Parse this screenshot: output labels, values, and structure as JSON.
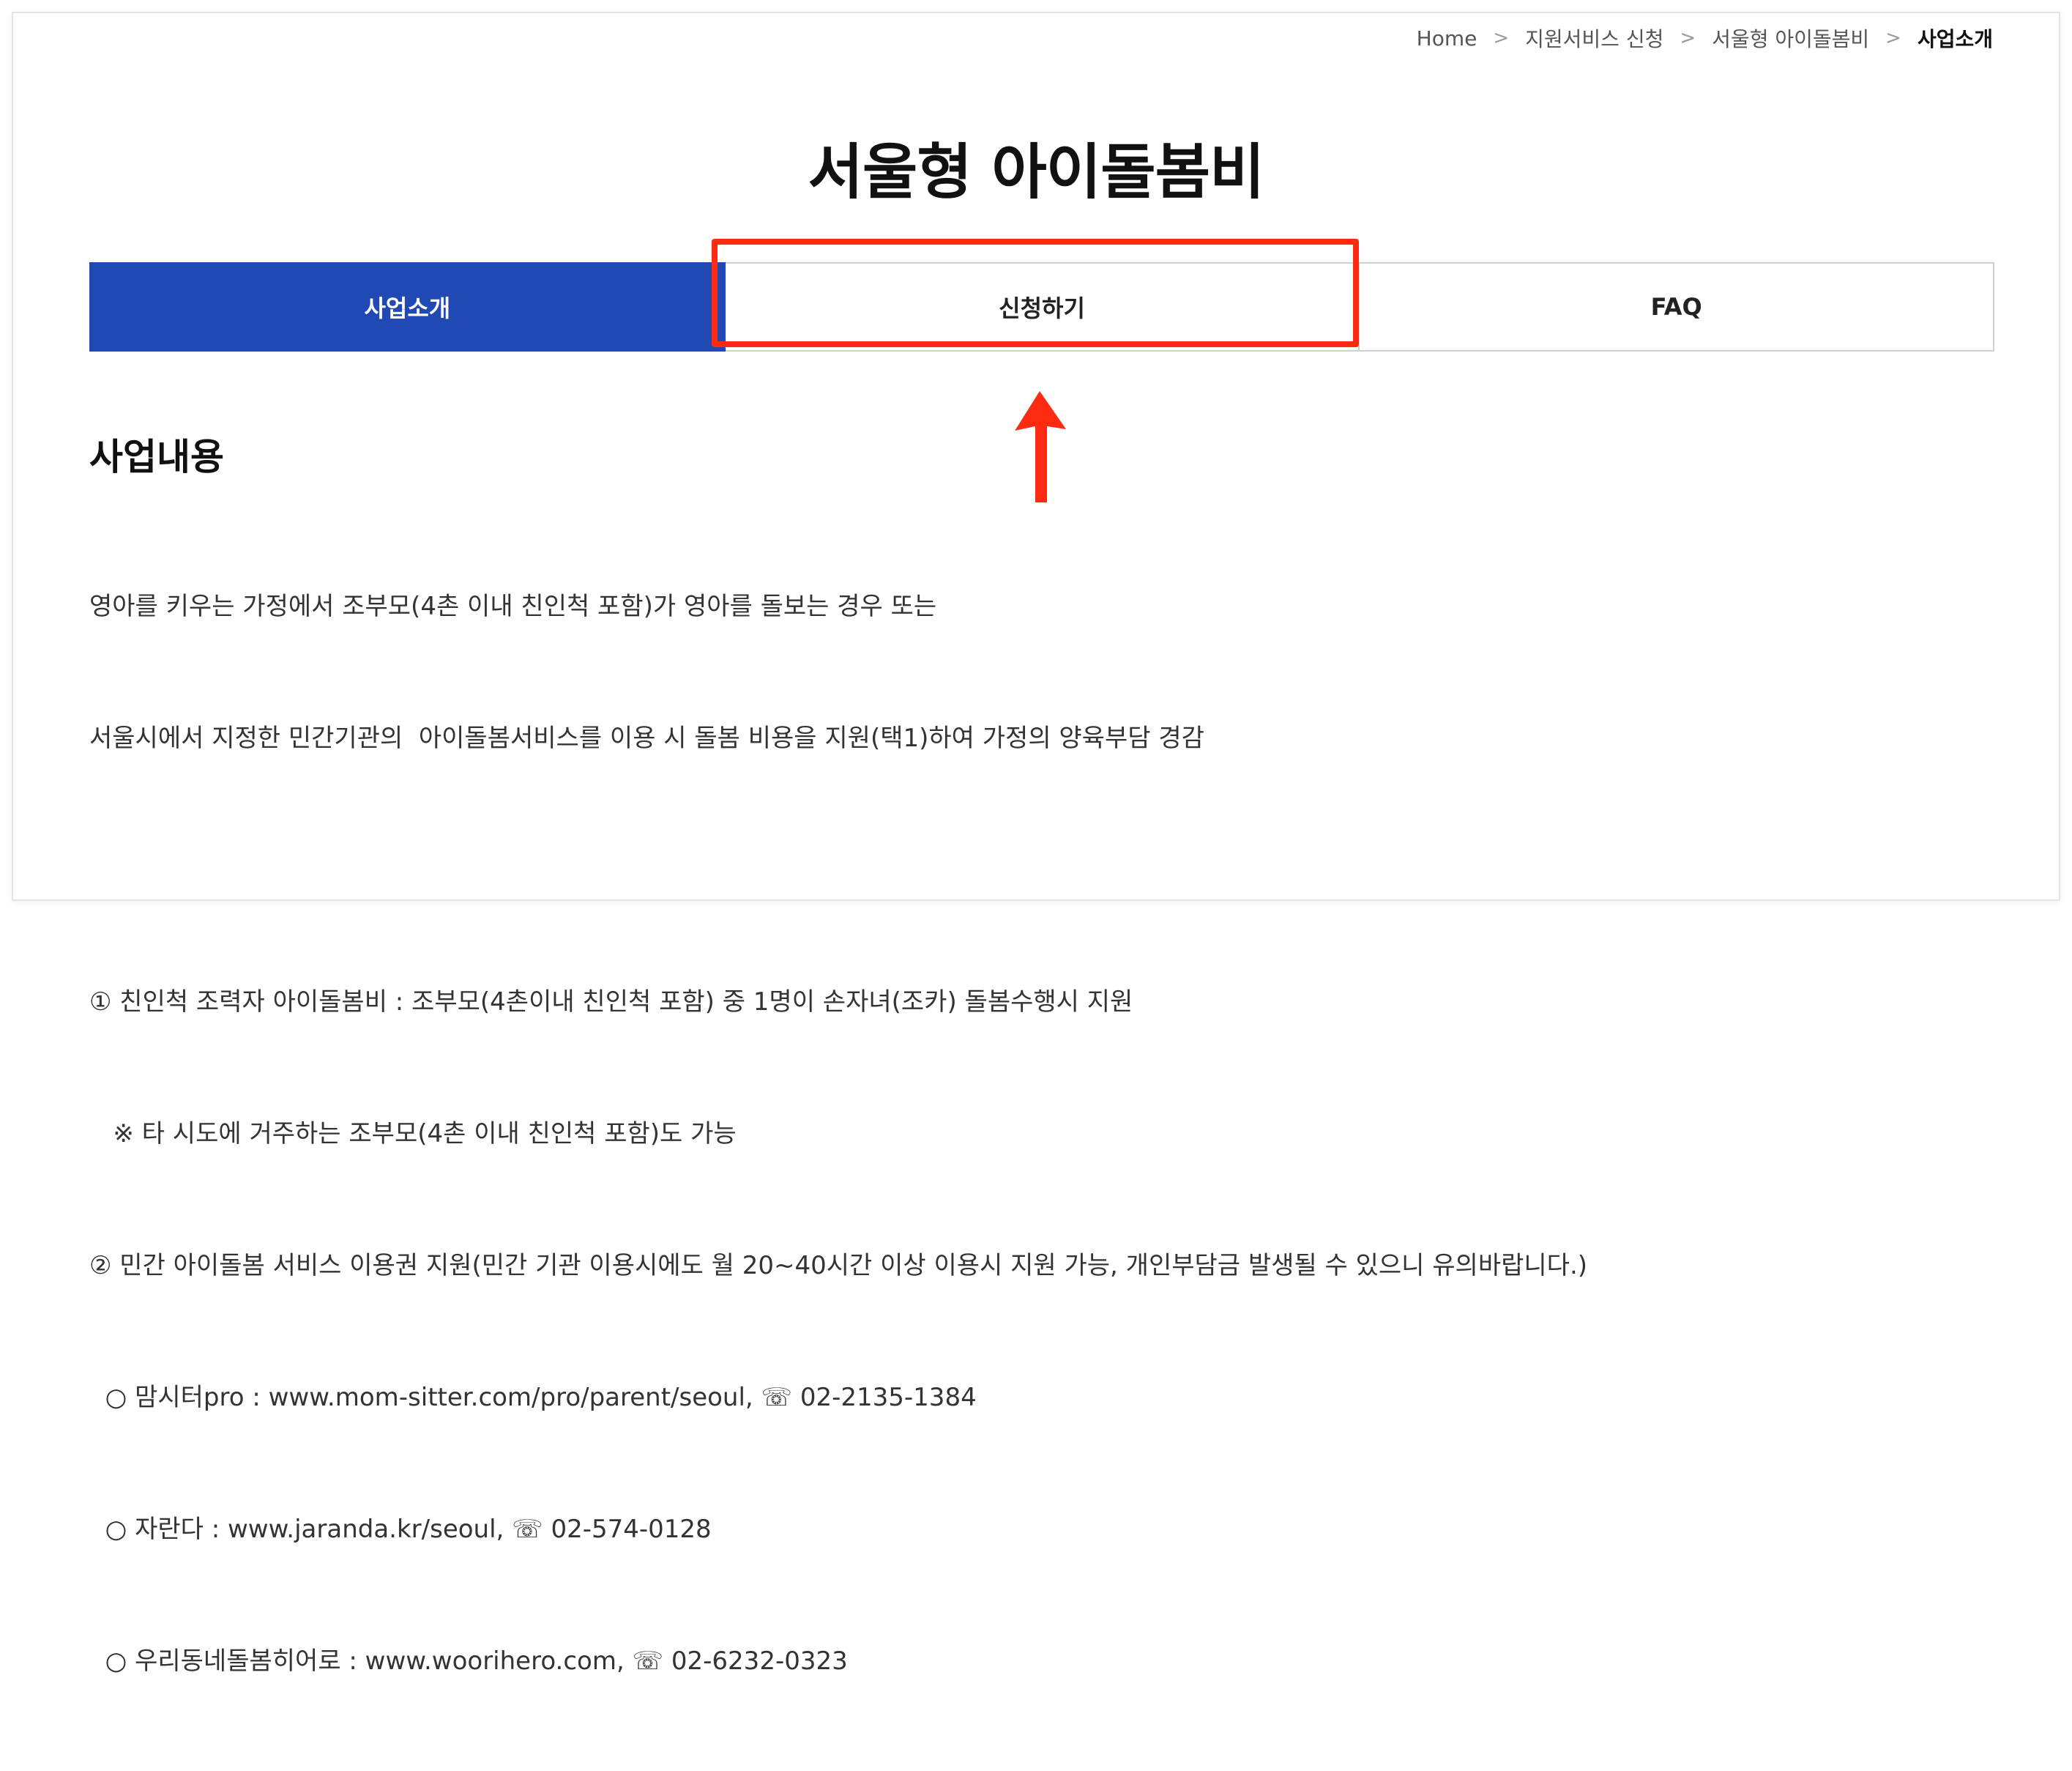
{
  "breadcrumb": {
    "items": [
      "Home",
      "지원서비스 신청",
      "서울형 아이돌봄비",
      "사업소개"
    ],
    "separator": ">"
  },
  "page": {
    "title": "서울형 아이돌봄비"
  },
  "tabs": [
    {
      "label": "사업소개",
      "active": true
    },
    {
      "label": "신청하기",
      "active": false
    },
    {
      "label": "FAQ",
      "active": false
    }
  ],
  "annotation": {
    "highlight_color": "#ff2a12"
  },
  "section": {
    "heading": "사업내용",
    "lines": [
      "영아를 키우는 가정에서 조부모(4촌 이내 친인척 포함)가 영아를 돌보는 경우 또는",
      "서울시에서 지정한 민간기관의  아이돌봄서비스를 이용 시 돌봄 비용을 지원(택1)하여 가정의 양육부담 경감",
      "",
      "① 친인척 조력자 아이돌봄비 : 조부모(4촌이내 친인척 포함) 중 1명이 손자녀(조카) 돌봄수행시 지원",
      "   ※ 타 시도에 거주하는 조부모(4촌 이내 친인척 포함)도 가능",
      "② 민간 아이돌봄 서비스 이용권 지원(민간 기관 이용시에도 월 20~40시간 이상 이용시 지원 가능, 개인부담금 발생될 수 있으니 유의바랍니다.)",
      "  ○ 맘시터pro : www.mom-sitter.com/pro/parent/seoul, ☏ 02-2135-1384",
      "  ○ 자란다 : www.jaranda.kr/seoul, ☏ 02-574-0128",
      "  ○ 우리동네돌봄히어로 : www.woorihero.com, ☏ 02-6232-0323"
    ]
  },
  "colors": {
    "tab_active_bg": "#2149b3",
    "tab_border": "#cfcfcf"
  }
}
